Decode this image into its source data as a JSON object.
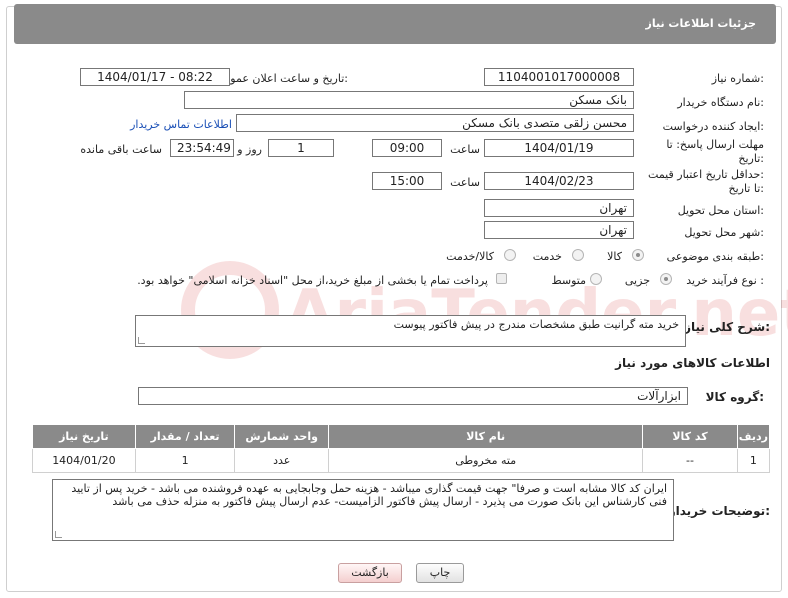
{
  "header": {
    "title": "جزئیات اطلاعات نیاز"
  },
  "form": {
    "need_number_label": "شماره نیاز:",
    "need_number": "1104001017000008",
    "announce_label": "تاریخ و ساعت اعلان عمومی:",
    "announce_value": "1404/01/17 - 08:22",
    "buyer_org_label": "نام دستگاه خریدار:",
    "buyer_org": "بانک مسکن",
    "creator_label": "ایجاد کننده درخواست:",
    "creator": "محسن زلقی متصدی بانک مسکن",
    "contact_link": "اطلاعات تماس خریدار",
    "deadline_label_1": "مهلت ارسال پاسخ: تا",
    "deadline_label_2": "تاریخ:",
    "deadline_date": "1404/01/19",
    "time_label": "ساعت",
    "deadline_time": "09:00",
    "days_value": "1",
    "days_label": "روز و",
    "remaining_time": "23:54:49",
    "remaining_label": "ساعت باقی مانده",
    "validity_label_1": "حداقل تاریخ اعتبار قیمت:",
    "validity_label_2": "تا تاریخ:",
    "validity_date": "1404/02/23",
    "validity_time": "15:00",
    "province_label": "استان محل تحویل:",
    "province": "تهران",
    "city_label": "شهر محل تحویل:",
    "city": "تهران",
    "category_label": "طبقه بندی موضوعی:",
    "category_options": [
      "کالا",
      "خدمت",
      "کالا/خدمت"
    ],
    "category_selected": "کالا",
    "process_label": "نوع فرآیند خرید :",
    "process_options": [
      "جزیی",
      "متوسط"
    ],
    "process_selected": "جزیی",
    "payment_note": "پرداخت تمام یا بخشی از مبلغ خرید،از محل \"اسناد خزانه اسلامی\" خواهد بود.",
    "description_label": "شرح کلی نیاز:",
    "description": "خرید مته گرانیت طبق مشخصات مندرج در پیش فاکتور پیوست"
  },
  "goods": {
    "section_title": "اطلاعات کالاهای مورد نیاز",
    "group_label": "گروه کالا:",
    "group_value": "ابزارآلات",
    "columns": [
      "ردیف",
      "کد کالا",
      "نام کالا",
      "واحد شمارش",
      "تعداد / مقدار",
      "تاریخ نیاز"
    ],
    "rows": [
      {
        "row": "1",
        "code": "--",
        "name": "مته مخروطی",
        "unit": "عدد",
        "qty": "1",
        "date": "1404/01/20"
      }
    ]
  },
  "buyer_notes": {
    "label": "توضیحات خریدار:",
    "text": "ایران کد کالا مشابه است و صرفا\" جهت قیمت گذاری میباشد - هزینه حمل وجابجایی به عهده فروشنده می باشد - خرید پس از تایید فنی کارشناس این بانک صورت می پذیرد - ارسال پیش فاکتور الزامیست- عدم ارسال پیش فاکتور به منزله حذف می باشد"
  },
  "buttons": {
    "print": "چاپ",
    "back": "بازگشت"
  },
  "watermark": {
    "text": "AriaTender.net"
  },
  "colors": {
    "header_bg": "#8a8a8a",
    "link": "#1a4fb6",
    "back_button": "#f4cfcf"
  }
}
